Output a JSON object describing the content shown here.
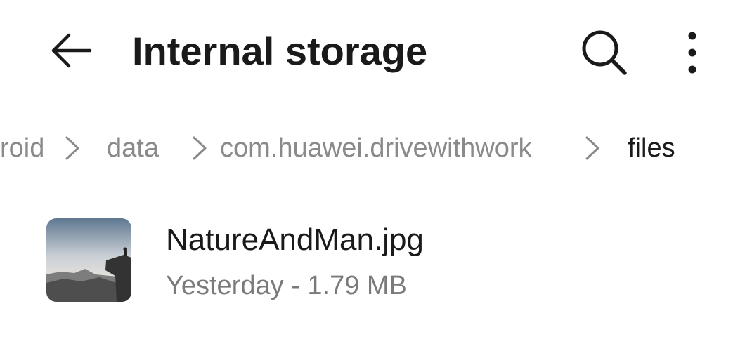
{
  "header": {
    "title": "Internal storage",
    "back_icon": "back-arrow-icon",
    "search_icon": "search-icon",
    "more_icon": "more-vertical-icon"
  },
  "breadcrumb": {
    "items": [
      {
        "label": "roid"
      },
      {
        "label": "data"
      },
      {
        "label": "com.huawei.drivewithwork"
      },
      {
        "label": "files"
      }
    ],
    "separator_icon": "chevron-right-icon"
  },
  "files": [
    {
      "name": "NatureAndMan.jpg",
      "meta": "Yesterday - 1.79 MB",
      "thumbnail_icon": "image-thumbnail"
    }
  ],
  "colors": {
    "primary_text": "#1a1a1a",
    "secondary_text": "#7a7a7a",
    "breadcrumb_inactive": "#8a8a8a",
    "background": "#ffffff"
  }
}
